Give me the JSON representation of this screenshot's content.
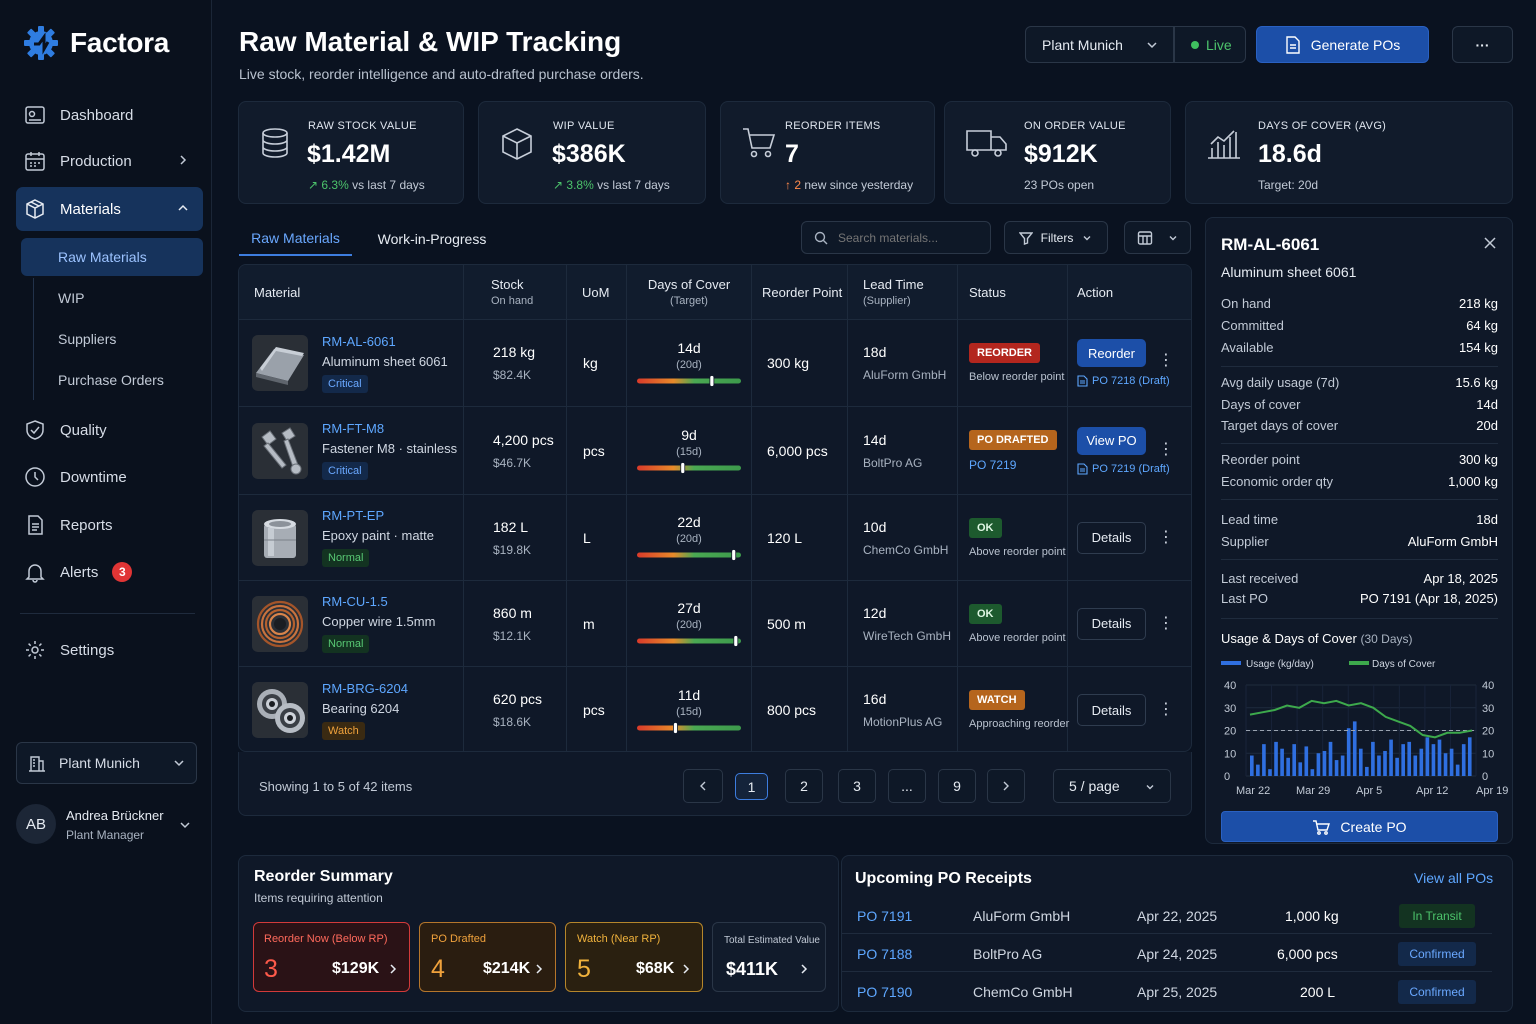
{
  "app": {
    "name": "Factora"
  },
  "nav": {
    "dashboard": "Dashboard",
    "production": "Production",
    "materials": "Materials",
    "sub": [
      "Raw Materials",
      "WIP",
      "Suppliers",
      "Purchase Orders"
    ],
    "quality": "Quality",
    "downtime": "Downtime",
    "reports": "Reports",
    "alerts": "Alerts",
    "alerts_count": "3",
    "settings": "Settings",
    "plant": "Plant Munich",
    "user_initials": "AB",
    "user_name": "Andrea Brückner",
    "user_role": "Plant Manager"
  },
  "header": {
    "title": "Raw Material & WIP Tracking",
    "subtitle": "Live stock, reorder intelligence and auto-drafted purchase orders.",
    "plant_select": "Plant Munich",
    "live": "Live",
    "generate": "Generate POs",
    "more": "···"
  },
  "kpis": [
    {
      "label": "RAW STOCK VALUE",
      "value": "$1.42M",
      "delta": "6.3%",
      "note": "vs last 7 days"
    },
    {
      "label": "WIP VALUE",
      "value": "$386K",
      "delta": "3.8%",
      "note": "vs last 7 days"
    },
    {
      "label": "REORDER ITEMS",
      "value": "7",
      "delta": "2",
      "note": "new since yesterday"
    },
    {
      "label": "ON ORDER VALUE",
      "value": "$912K",
      "delta": "23 POs open",
      "note": ""
    },
    {
      "label": "DAYS OF COVER (AVG)",
      "value": "18.6d",
      "delta": "Target: 20d",
      "note": ""
    }
  ],
  "tabs": [
    "Raw Materials",
    "Work-in-Progress"
  ],
  "toolbar": {
    "search_placeholder": "Search materials...",
    "filters": "Filters"
  },
  "table": {
    "headers": {
      "material": "Material",
      "stock": "Stock",
      "stock_sub": "On hand",
      "uom": "UoM",
      "cover": "Days of Cover",
      "cover_sub": "(Target)",
      "reorder": "Reorder Point",
      "lead": "Lead Time",
      "lead_sub": "(Supplier)",
      "status": "Status",
      "action": "Action"
    },
    "rows": [
      {
        "code": "RM-AL-6061",
        "desc": "Aluminum sheet 6061",
        "tag": "Critical",
        "stock": "218 kg",
        "value": "$82.4K",
        "uom": "kg",
        "cover": "14d",
        "target": "(20d)",
        "cover_frac": 0.72,
        "rp": "300 kg",
        "lead": "18d",
        "supplier": "AluForm GmbH",
        "status": "REORDER",
        "status_sub": "Below reorder point",
        "action": "Reorder",
        "po": "PO 7218 (Draft)"
      },
      {
        "code": "RM-FT-M8",
        "desc": "Fastener M8 · stainless",
        "tag": "Critical",
        "stock": "4,200 pcs",
        "value": "$46.7K",
        "uom": "pcs",
        "cover": "9d",
        "target": "(15d)",
        "cover_frac": 0.44,
        "rp": "6,000 pcs",
        "lead": "14d",
        "supplier": "BoltPro AG",
        "status": "PO DRAFTED",
        "status_sub": "PO 7219",
        "action": "View PO",
        "po": "PO 7219 (Draft)"
      },
      {
        "code": "RM-PT-EP",
        "desc": "Epoxy paint · matte",
        "tag": "Normal",
        "stock": "182 L",
        "value": "$19.8K",
        "uom": "L",
        "cover": "22d",
        "target": "(20d)",
        "cover_frac": 0.93,
        "rp": "120 L",
        "lead": "10d",
        "supplier": "ChemCo GmbH",
        "status": "OK",
        "status_sub": "Above reorder point",
        "action": "Details",
        "po": ""
      },
      {
        "code": "RM-CU-1.5",
        "desc": "Copper wire 1.5mm",
        "tag": "Normal",
        "stock": "860 m",
        "value": "$12.1K",
        "uom": "m",
        "cover": "27d",
        "target": "(20d)",
        "cover_frac": 0.95,
        "rp": "500 m",
        "lead": "12d",
        "supplier": "WireTech GmbH",
        "status": "OK",
        "status_sub": "Above reorder point",
        "action": "Details",
        "po": ""
      },
      {
        "code": "RM-BRG-6204",
        "desc": "Bearing 6204",
        "tag": "Watch",
        "stock": "620 pcs",
        "value": "$18.6K",
        "uom": "pcs",
        "cover": "11d",
        "target": "(15d)",
        "cover_frac": 0.37,
        "rp": "800 pcs",
        "lead": "16d",
        "supplier": "MotionPlus AG",
        "status": "WATCH",
        "status_sub": "Approaching reorder",
        "action": "Details",
        "po": ""
      }
    ]
  },
  "pagination": {
    "showing": "Showing 1 to 5 of 42 items",
    "pages": [
      "1",
      "2",
      "3",
      "...",
      "9"
    ],
    "per_page": "5 / page"
  },
  "detail": {
    "code": "RM-AL-6061",
    "name": "Aluminum sheet 6061",
    "rows": [
      {
        "label": "On hand",
        "value": "218 kg"
      },
      {
        "label": "Committed",
        "value": "64 kg"
      },
      {
        "label": "Available",
        "value": "154 kg"
      },
      {
        "label": "Avg daily usage (7d)",
        "value": "15.6 kg"
      },
      {
        "label": "Days of cover",
        "value": "14d"
      },
      {
        "label": "Target days of cover",
        "value": "20d"
      },
      {
        "label": "Reorder point",
        "value": "300 kg"
      },
      {
        "label": "Economic order qty",
        "value": "1,000 kg"
      },
      {
        "label": "Lead time",
        "value": "18d"
      },
      {
        "label": "Supplier",
        "value": "AluForm GmbH"
      },
      {
        "label": "Last received",
        "value": "Apr 18, 2025"
      },
      {
        "label": "Last PO",
        "value": "PO 7191 (Apr 18, 2025)"
      }
    ],
    "chart_title": "Usage & Days of Cover",
    "chart_period": "(30 Days)",
    "create_po": "Create PO"
  },
  "chart_data": {
    "type": "bar",
    "title": "Usage & Days of Cover",
    "legend": [
      "Usage (kg/day)",
      "Days of Cover"
    ],
    "x_ticks": [
      "Mar 22",
      "Mar 29",
      "Apr 5",
      "Apr 12",
      "Apr 19"
    ],
    "y_ticks": [
      "40",
      "30",
      "20",
      "10",
      "0"
    ],
    "ylim": [
      0,
      40
    ],
    "target_line": 20,
    "series": [
      {
        "name": "Usage (kg/day)",
        "values": [
          9,
          5,
          14,
          3,
          15,
          12,
          8,
          14,
          6,
          13,
          3,
          10,
          11,
          15,
          7,
          9,
          21,
          24,
          12,
          4,
          15,
          9,
          11,
          16,
          8,
          14,
          15,
          9,
          12,
          17,
          14,
          16,
          10,
          12,
          5,
          14,
          17
        ]
      },
      {
        "name": "Days of Cover",
        "values": [
          27,
          28,
          29,
          31,
          30,
          33,
          32,
          33,
          31,
          32,
          30,
          26,
          24,
          22,
          18,
          17,
          19,
          19,
          20
        ]
      }
    ]
  },
  "summary": {
    "title": "Reorder Summary",
    "subtitle": "Items requiring attention",
    "cards": [
      {
        "label": "Reorder Now (Below RP)",
        "count": "3",
        "value": "$129K"
      },
      {
        "label": "PO Drafted",
        "count": "4",
        "value": "$214K"
      },
      {
        "label": "Watch (Near RP)",
        "count": "5",
        "value": "$68K"
      },
      {
        "label": "Total Estimated Value",
        "count": "",
        "value": "$411K"
      }
    ]
  },
  "receipts": {
    "title": "Upcoming PO Receipts",
    "view_all": "View all POs",
    "rows": [
      {
        "po": "PO 7191",
        "supplier": "AluForm GmbH",
        "date": "Apr 22, 2025",
        "qty": "1,000 kg",
        "status": "In Transit"
      },
      {
        "po": "PO 7188",
        "supplier": "BoltPro AG",
        "date": "Apr 24, 2025",
        "qty": "6,000 pcs",
        "status": "Confirmed"
      },
      {
        "po": "PO 7190",
        "supplier": "ChemCo GmbH",
        "date": "Apr 25, 2025",
        "qty": "200 L",
        "status": "Confirmed"
      }
    ]
  },
  "colors": {
    "accent": "#1c4fa8",
    "link": "#5ea7ff",
    "green": "#4cc36b",
    "red": "#e03535",
    "orange": "#f0a23c"
  }
}
